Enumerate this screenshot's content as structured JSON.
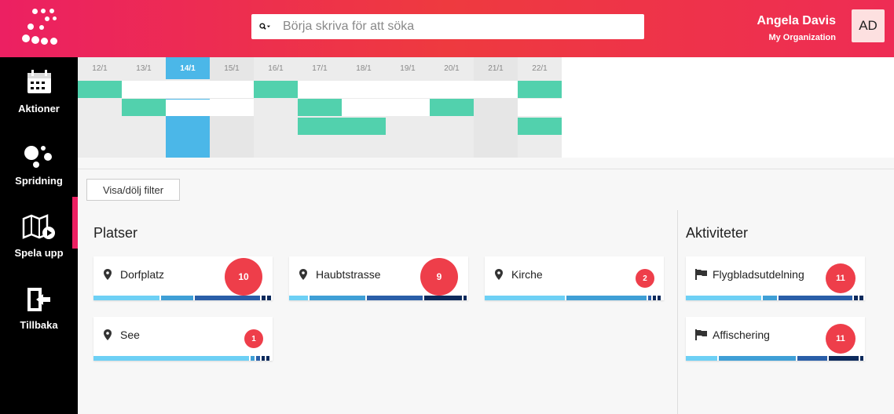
{
  "header": {
    "search_placeholder": "Börja skriva för att söka",
    "user_name": "Angela Davis",
    "user_org": "My Organization",
    "avatar_initials": "AD",
    "gradient_colors": [
      "#ec2062",
      "#ee3a3f"
    ]
  },
  "sidebar": {
    "items": [
      {
        "label": "Aktioner",
        "icon": "calendar-icon"
      },
      {
        "label": "Spridning",
        "icon": "dots-icon"
      },
      {
        "label": "Spela upp",
        "icon": "map-play-icon"
      },
      {
        "label": "Tillbaka",
        "icon": "exit-icon"
      }
    ],
    "active": "Spridning"
  },
  "timeline": {
    "dates": [
      "12/1",
      "13/1",
      "14/1",
      "15/1",
      "16/1",
      "17/1",
      "18/1",
      "19/1",
      "20/1",
      "21/1",
      "22/1"
    ],
    "today": "14/1"
  },
  "filter_button": "Visa/dölj filter",
  "places": {
    "title": "Platser",
    "cards": [
      {
        "name": "Dorfplatz",
        "count": "10"
      },
      {
        "name": "Haubtstrasse",
        "count": "9"
      },
      {
        "name": "Kirche",
        "count": "2"
      },
      {
        "name": "See",
        "count": "1"
      }
    ]
  },
  "activities": {
    "title": "Aktiviteter",
    "cards": [
      {
        "name": "Flygbladsutdelning",
        "count": "11"
      },
      {
        "name": "Affischering",
        "count": "11"
      }
    ]
  },
  "colors": {
    "accent": "#ec2062",
    "green": "#52d1ad",
    "blue": "#4bb7e8",
    "badge": "#ee3e4a",
    "bar_light": "#6dd0f5",
    "bar_mid": "#3f9fd6",
    "bar_dark": "#2a5ea8",
    "bar_navy": "#0d2a5c"
  }
}
